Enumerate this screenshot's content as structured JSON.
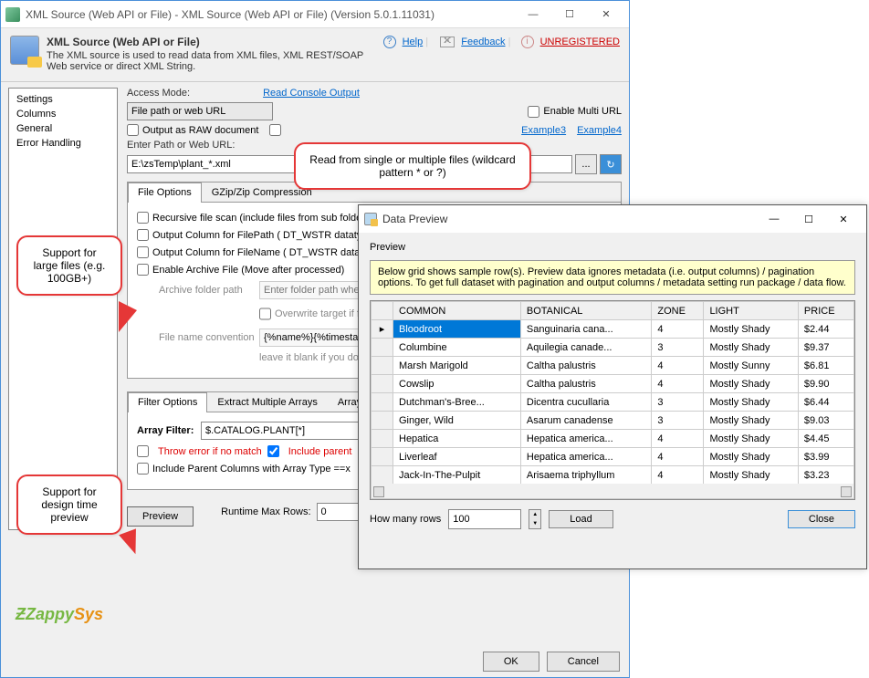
{
  "window": {
    "title": "XML Source (Web API or File) - XML Source (Web API or File) (Version 5.0.1.11031)"
  },
  "header": {
    "title": "XML Source (Web API or File)",
    "desc": "The XML source is used to read data from XML files, XML REST/SOAP Web service or direct XML String.",
    "help": "Help",
    "feedback": "Feedback",
    "unregistered": "UNREGISTERED"
  },
  "sidebar": {
    "items": [
      "Settings",
      "Columns",
      "General",
      "Error Handling"
    ]
  },
  "form": {
    "access_mode_label": "Access Mode:",
    "read_console_link": "Read Console Output",
    "access_mode_value": "File path or web URL",
    "output_raw": "Output as RAW document",
    "enable_multi": "Enable Multi URL",
    "example3": "Example3",
    "example4": "Example4",
    "enter_path_label": "Enter Path or Web URL:",
    "path_value": "E:\\zsTemp\\plant_*.xml"
  },
  "fileopts": {
    "tabs": [
      "File Options",
      "GZip/Zip Compression"
    ],
    "recursive": "Recursive file scan (include files from sub folders)",
    "filepath_col": "Output Column for FilePath ( DT_WSTR datatype )",
    "filename_col": "Output Column for FileName ( DT_WSTR datatype )",
    "archive": "Enable Archive File (Move after processed)",
    "archive_folder_lbl": "Archive folder path",
    "archive_folder_ph": "Enter folder path where you like to move files",
    "overwrite": "Overwrite target if file exists",
    "convention_lbl": "File name convention",
    "convention_val": "{%name%}{%timestamp%}{%ext%}",
    "convention_hint": "leave it blank if you dont wish to rename"
  },
  "filter": {
    "tabs": [
      "Filter Options",
      "Extract Multiple Arrays",
      "Array Handling"
    ],
    "array_filter_lbl": "Array Filter:",
    "array_filter_val": "$.CATALOG.PLANT[*]",
    "throw": "Throw error if no match",
    "include_parent": "Include parent",
    "include_parent_cols": "Include Parent Columns with Array Type ==x"
  },
  "preview_btn": "Preview",
  "runtime_label": "Runtime Max Rows:",
  "runtime_val": "0",
  "footer": {
    "ok": "OK",
    "cancel": "Cancel"
  },
  "callouts": {
    "c1": "Read from single or multiple files (wildcard pattern * or ?)",
    "c2": "Support for large files (e.g. 100GB+)",
    "c3": "Support for design time preview"
  },
  "preview": {
    "title": "Data Preview",
    "subtitle": "Preview",
    "note": "Below grid shows sample row(s). Preview data ignores metadata (i.e. output columns) / pagination options. To get full dataset with pagination and output columns / metadata setting run package / data flow.",
    "columns": [
      "COMMON",
      "BOTANICAL",
      "ZONE",
      "LIGHT",
      "PRICE"
    ],
    "rows": [
      [
        "Bloodroot",
        "Sanguinaria cana...",
        "4",
        "Mostly Shady",
        "$2.44"
      ],
      [
        "Columbine",
        "Aquilegia canade...",
        "3",
        "Mostly Shady",
        "$9.37"
      ],
      [
        "Marsh Marigold",
        "Caltha palustris",
        "4",
        "Mostly Sunny",
        "$6.81"
      ],
      [
        "Cowslip",
        "Caltha palustris",
        "4",
        "Mostly Shady",
        "$9.90"
      ],
      [
        "Dutchman's-Bree...",
        "Dicentra cucullaria",
        "3",
        "Mostly Shady",
        "$6.44"
      ],
      [
        "Ginger, Wild",
        "Asarum canadense",
        "3",
        "Mostly Shady",
        "$9.03"
      ],
      [
        "Hepatica",
        "Hepatica america...",
        "4",
        "Mostly Shady",
        "$4.45"
      ],
      [
        "Liverleaf",
        "Hepatica america...",
        "4",
        "Mostly Shady",
        "$3.99"
      ],
      [
        "Jack-In-The-Pulpit",
        "Arisaema triphyllum",
        "4",
        "Mostly Shady",
        "$3.23"
      ]
    ],
    "how_many": "How many rows",
    "how_many_val": "100",
    "load": "Load",
    "close": "Close"
  }
}
